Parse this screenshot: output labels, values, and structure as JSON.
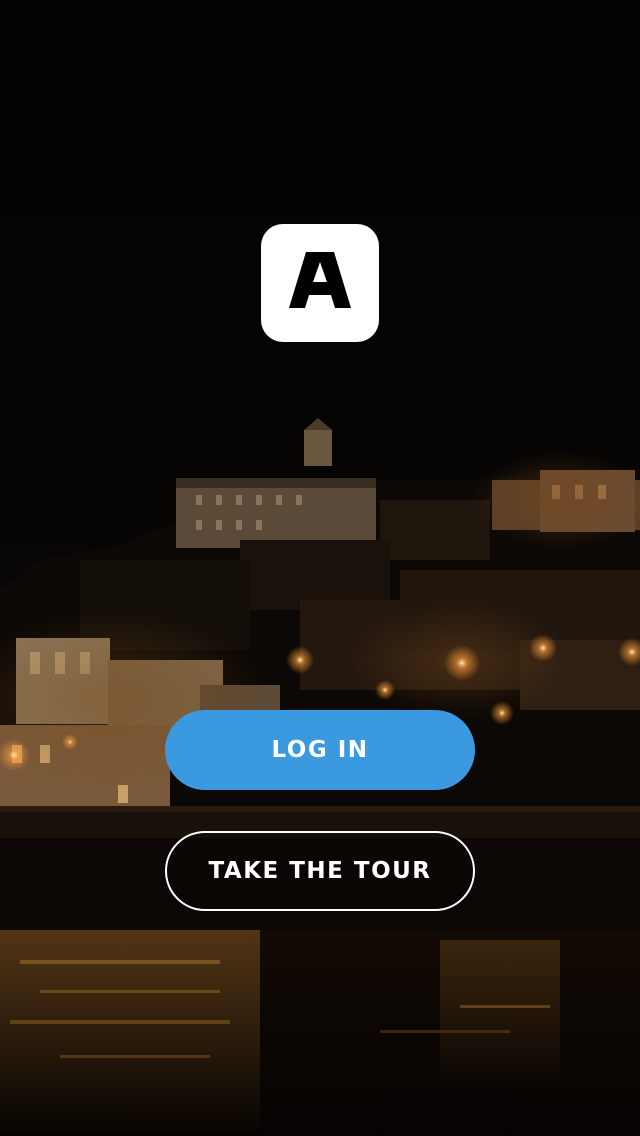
{
  "app": {
    "logo_icon": "app-logo-letter-a",
    "logo_letter": "A",
    "background_image": "night-city-hillside-river-photo"
  },
  "actions": {
    "login_label": "LOG IN",
    "tour_label": "TAKE THE TOUR"
  },
  "colors": {
    "login_button": "#3a99df",
    "tour_border": "#ffffff",
    "logo_background": "#ffffff",
    "logo_letter": "#000000"
  }
}
